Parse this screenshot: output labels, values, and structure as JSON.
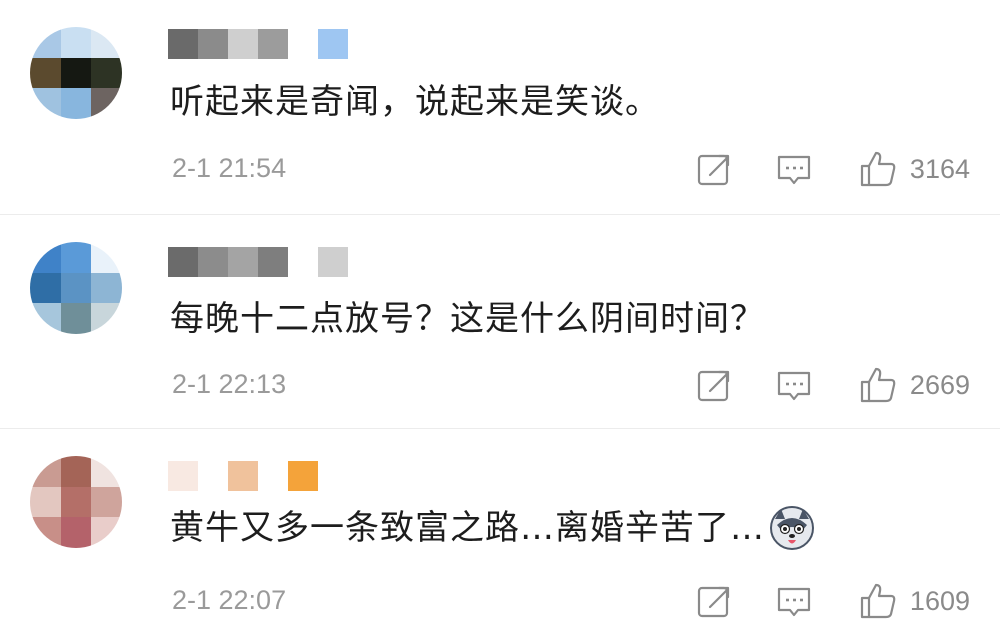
{
  "comments": [
    {
      "text": "听起来是奇闻，说起来是笑谈。",
      "time": "2-1 21:54",
      "likes": "3164",
      "avatar_colors": [
        "#a9c8e6",
        "#c9dff2",
        "#dbe8f3",
        "#5b4a2e",
        "#151812",
        "#2d3324",
        "#9fc2e0",
        "#88b6de",
        "#6d6461"
      ],
      "name_colors": [
        "#6a6a6a",
        "#8b8b8b",
        "#cfcfcf",
        "#9c9c9c",
        "#ffffff",
        "#9ec6f2"
      ],
      "has_emoji": false
    },
    {
      "text": "每晚十二点放号？这是什么阴间时间？",
      "time": "2-1 22:13",
      "likes": "2669",
      "avatar_colors": [
        "#3f82c8",
        "#5a9ad8",
        "#e9f2fa",
        "#2f6ea6",
        "#5b93c4",
        "#8db5d4",
        "#a6c6dc",
        "#6f8f99",
        "#c8d6db"
      ],
      "name_colors": [
        "#6b6b6b",
        "#8c8c8c",
        "#a4a4a4",
        "#7e7e7e",
        "#ffffff",
        "#cfcfcf"
      ],
      "has_emoji": false
    },
    {
      "text": "黄牛又多一条致富之路…离婚辛苦了…",
      "time": "2-1 22:07",
      "likes": "1609",
      "avatar_colors": [
        "#c99b92",
        "#a46457",
        "#f0e3e0",
        "#e3c7c0",
        "#b46f68",
        "#cfa49c",
        "#c88f88",
        "#b4626a",
        "#e9cdca"
      ],
      "name_colors": [
        "#f8e9e2",
        "#ffffff",
        "#f0c29c",
        "#ffffff",
        "#f4a33a"
      ],
      "has_emoji": true
    }
  ],
  "icons": {
    "share": "share-icon",
    "reply": "comment-icon",
    "like": "thumbs-up-icon",
    "emoji": "husky-dog-emoji-icon"
  }
}
